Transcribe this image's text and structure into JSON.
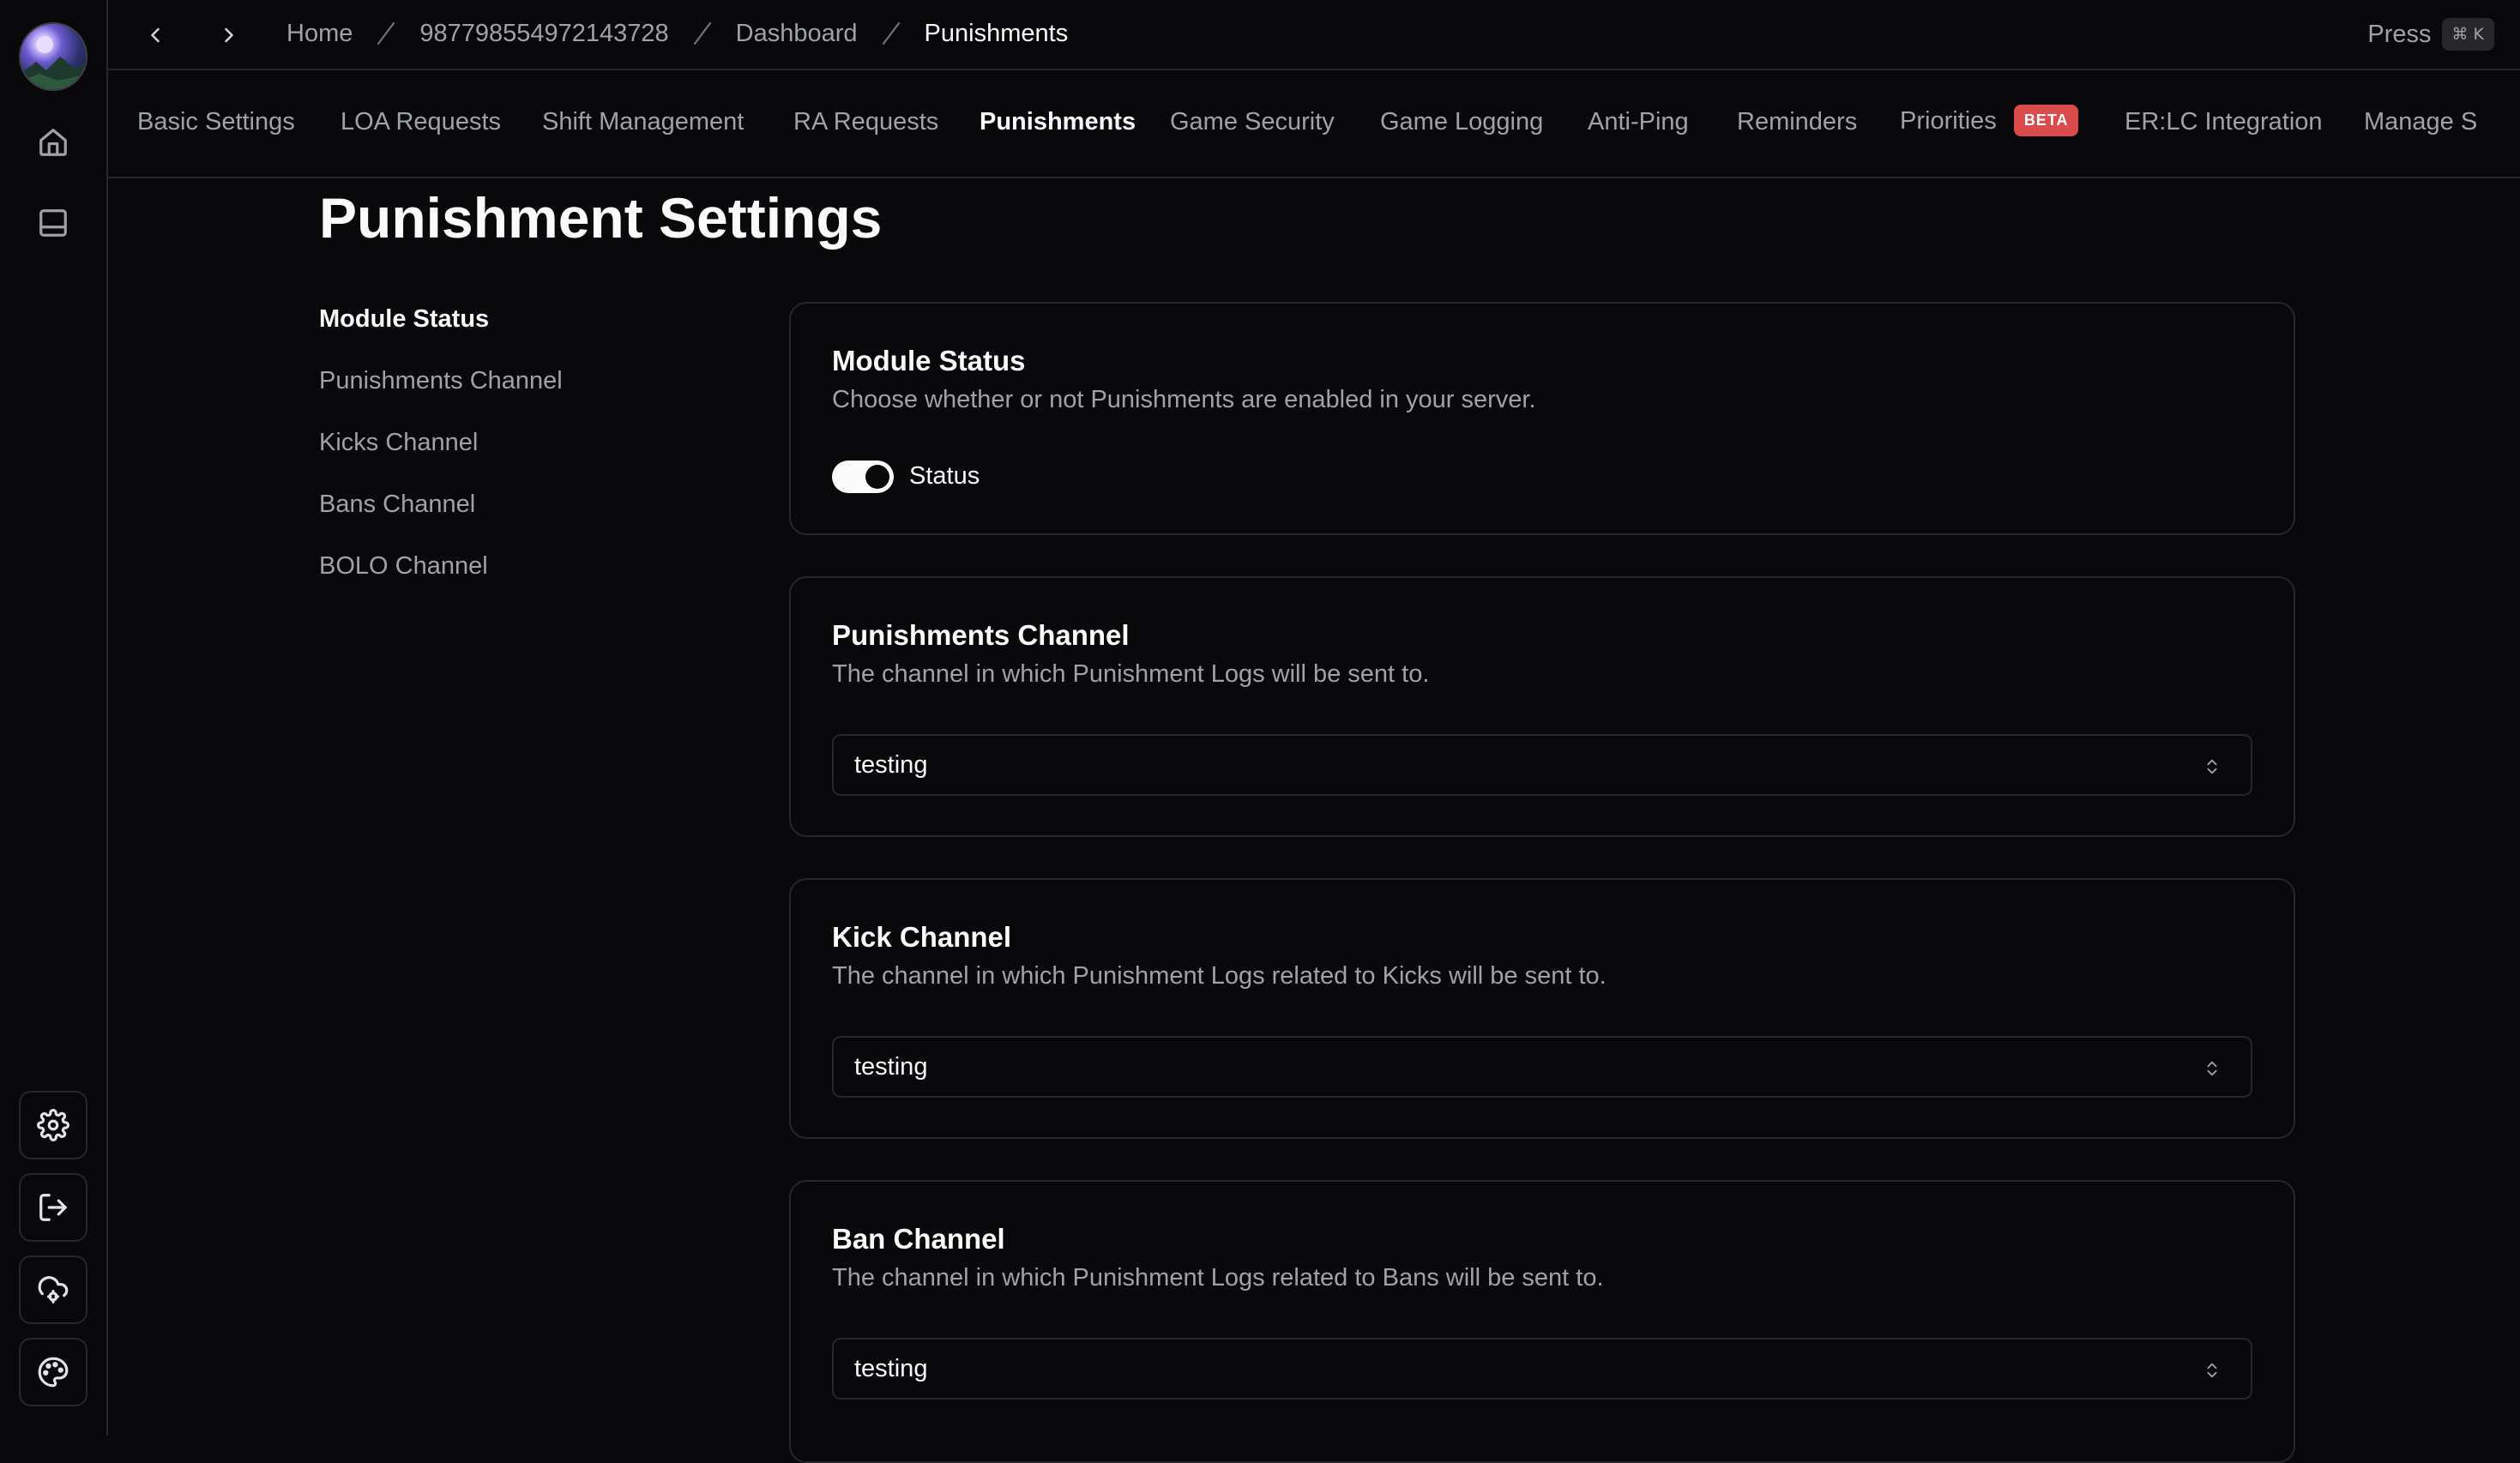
{
  "breadcrumb": {
    "items": [
      "Home",
      "987798554972143728",
      "Dashboard",
      "Punishments"
    ]
  },
  "command_hint": {
    "label": "Press",
    "shortcut": "⌘ K"
  },
  "tabs": [
    {
      "label": "Basic Settings"
    },
    {
      "label": "LOA Requests"
    },
    {
      "label": "Shift Management"
    },
    {
      "label": "RA Requests"
    },
    {
      "label": "Punishments",
      "active": true
    },
    {
      "label": "Game Security"
    },
    {
      "label": "Game Logging"
    },
    {
      "label": "Anti-Ping"
    },
    {
      "label": "Reminders"
    },
    {
      "label": "Priorities",
      "badge": "BETA"
    },
    {
      "label": "ER:LC Integration"
    },
    {
      "label": "Manage S"
    }
  ],
  "page": {
    "title": "Punishment Settings"
  },
  "side_nav": [
    {
      "label": "Module Status",
      "active": true
    },
    {
      "label": "Punishments Channel"
    },
    {
      "label": "Kicks Channel"
    },
    {
      "label": "Bans Channel"
    },
    {
      "label": "BOLO Channel"
    }
  ],
  "cards": {
    "module_status": {
      "title": "Module Status",
      "description": "Choose whether or not Punishments are enabled in your server.",
      "toggle_label": "Status",
      "enabled": true
    },
    "punishments_channel": {
      "title": "Punishments Channel",
      "description": "The channel in which Punishment Logs will be sent to.",
      "value": "testing"
    },
    "kick_channel": {
      "title": "Kick Channel",
      "description": "The channel in which Punishment Logs related to Kicks will be sent to.",
      "value": "testing"
    },
    "ban_channel": {
      "title": "Ban Channel",
      "description": "The channel in which Punishment Logs related to Bans will be sent to.",
      "value": "testing"
    }
  },
  "colors": {
    "background": "#09090b",
    "border": "#27272a",
    "muted_text": "#a1a1aa",
    "text": "#fafafa",
    "beta_badge": "#dc4b4b"
  },
  "icons": {
    "rail": [
      "home-icon",
      "book-icon"
    ],
    "rail_buttons": [
      "settings-gear-icon",
      "logout-icon",
      "cloud-settings-icon",
      "palette-icon"
    ]
  }
}
